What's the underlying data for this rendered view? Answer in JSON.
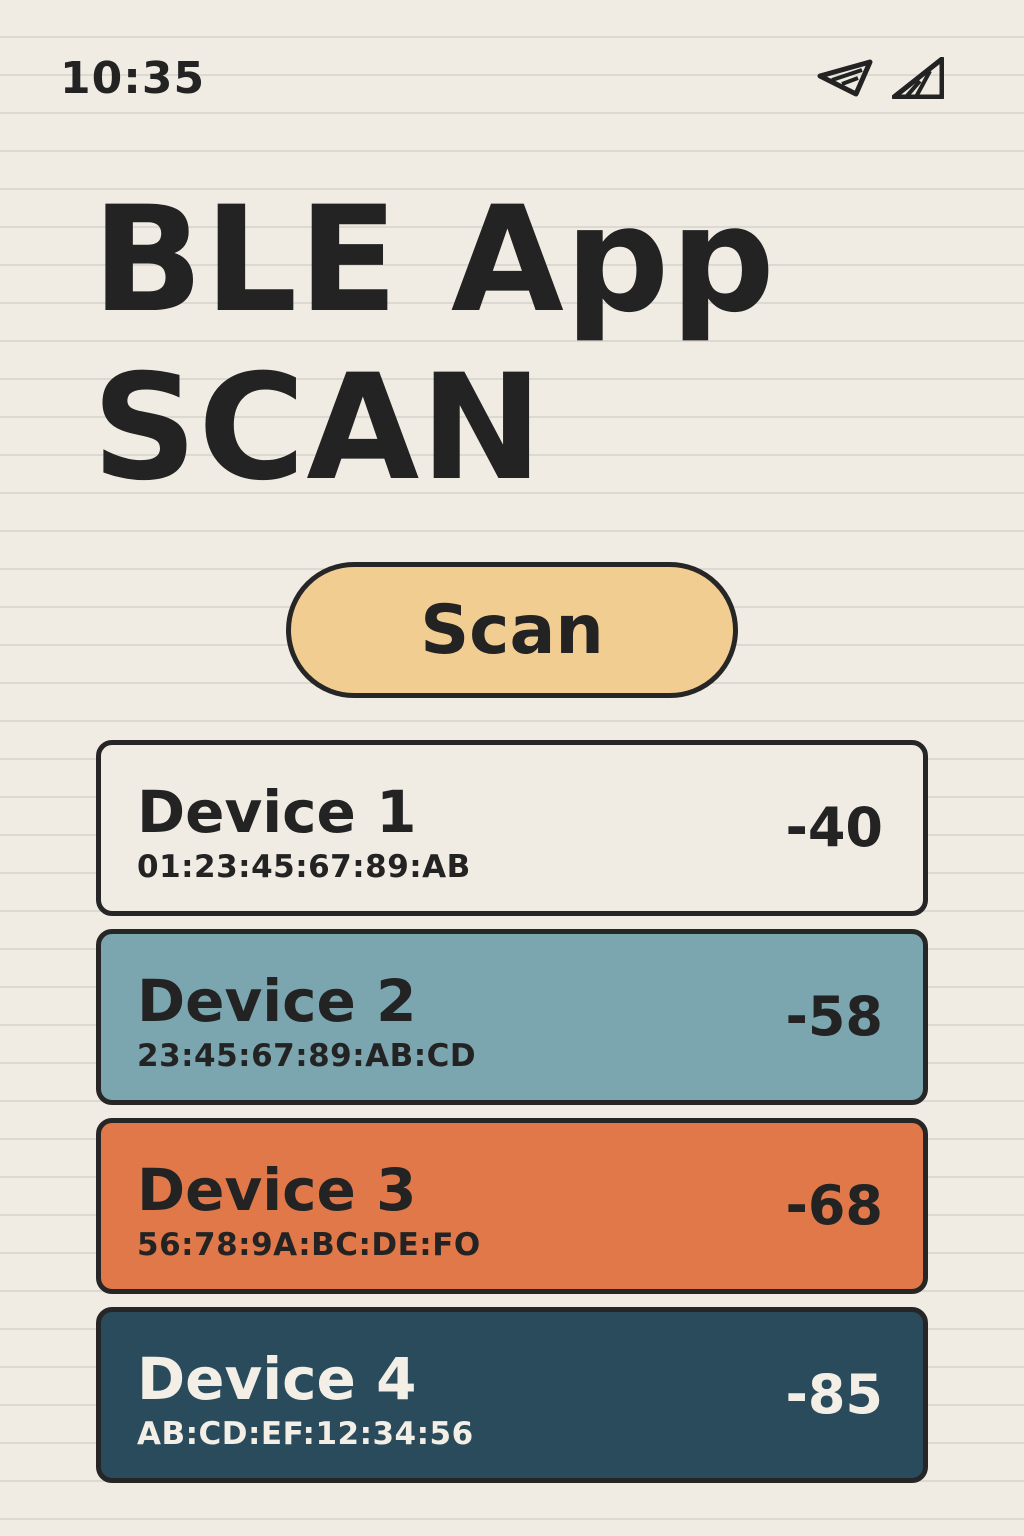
{
  "status_bar": {
    "time": "10:35",
    "icons": [
      "wifi-icon",
      "cellular-signal-icon"
    ]
  },
  "header": {
    "title_line1": "BLE App",
    "title_line2": "SCAN"
  },
  "scan_button": {
    "label": "Scan",
    "color": "#f2cd92"
  },
  "devices": [
    {
      "name": "Device 1",
      "mac": "01:23:45:67:89:AB",
      "rssi": "-40",
      "bg_color": "#f1ece3",
      "text_color": "#232323"
    },
    {
      "name": "Device 2",
      "mac": "23:45:67:89:AB:CD",
      "rssi": "-58",
      "bg_color": "#7ba6b0",
      "text_color": "#232323"
    },
    {
      "name": "Device 3",
      "mac": "56:78:9A:BC:DE:FO",
      "rssi": "-68",
      "bg_color": "#e0784a",
      "text_color": "#232323"
    },
    {
      "name": "Device 4",
      "mac": "AB:CD:EF:12:34:56",
      "rssi": "-85",
      "bg_color": "#2a4b5b",
      "text_color": "#f3efe6"
    }
  ],
  "colors": {
    "background": "#f1ece3",
    "ink": "#232323"
  }
}
